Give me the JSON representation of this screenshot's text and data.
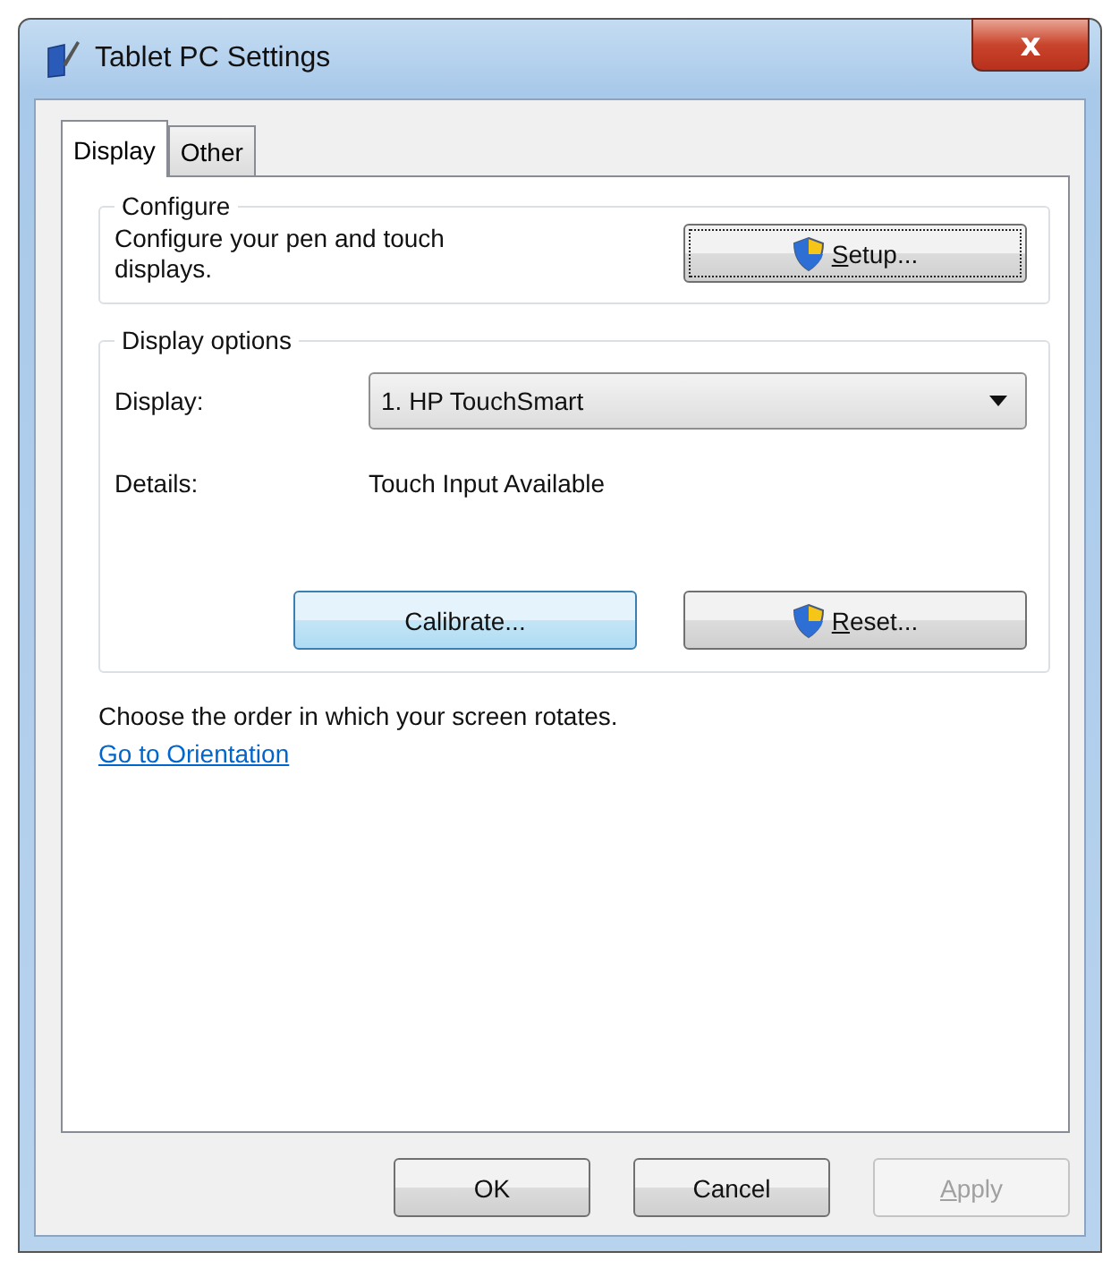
{
  "window": {
    "title": "Tablet PC Settings",
    "close_label": "x"
  },
  "tabs": [
    {
      "label": "Display",
      "selected": true
    },
    {
      "label": "Other",
      "selected": false
    }
  ],
  "configure": {
    "heading": "Configure",
    "description": "Configure your pen and touch displays.",
    "button": {
      "label": "Setup...",
      "shield": true,
      "focused": true,
      "highlighted": false,
      "underline_first": true
    }
  },
  "display_options": {
    "heading": "Display options",
    "display_label": "Display:",
    "display_value": "1. HP TouchSmart",
    "details_label": "Details:",
    "details_value": "Touch Input Available",
    "buttons": [
      {
        "label": "Calibrate...",
        "shield": false,
        "focused": false,
        "highlighted": true,
        "underline_first": false
      },
      {
        "label": "Reset...",
        "shield": true,
        "focused": false,
        "highlighted": false,
        "underline_first": true
      }
    ]
  },
  "orientation": {
    "text": "Choose the order in which your screen rotates.",
    "link": "Go to Orientation"
  },
  "buttons": [
    {
      "label": "OK",
      "disabled": false,
      "underline_first": false
    },
    {
      "label": "Cancel",
      "disabled": false,
      "underline_first": false
    },
    {
      "label": "Apply",
      "disabled": true,
      "underline_first": true
    }
  ]
}
